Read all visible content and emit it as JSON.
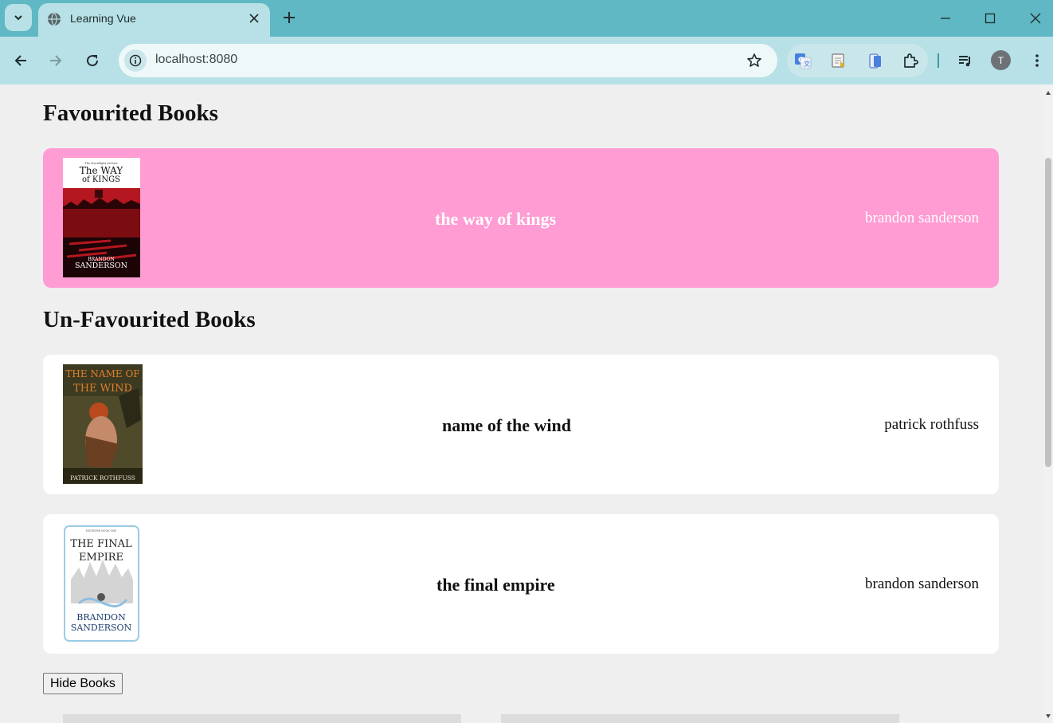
{
  "browser": {
    "tab_title": "Learning Vue",
    "url": "localhost:8080",
    "profile_initial": "T"
  },
  "page": {
    "favourited_heading": "Favourited Books",
    "unfavourited_heading": "Un-Favourited Books",
    "favourited_books": [
      {
        "title": "the way of kings",
        "author": "brandon sanderson",
        "cover": {
          "top_small": "The Stormlight Archive",
          "title_line1": "The WAY",
          "title_line2": "of KINGS",
          "author_line1": "BRANDON",
          "author_line2": "SANDERSON"
        }
      }
    ],
    "unfavourited_books": [
      {
        "title": "name of the wind",
        "author": "patrick rothfuss",
        "cover": {
          "title_line1": "THE NAME OF",
          "title_line2": "THE WIND",
          "author_line1": "PATRICK ROTHFUSS"
        }
      },
      {
        "title": "the final empire",
        "author": "brandon sanderson",
        "cover": {
          "top_small": "MISTBORN BOOK ONE",
          "title_line1": "THE FINAL",
          "title_line2": "EMPIRE",
          "author_line1": "BRANDON",
          "author_line2": "SANDERSON"
        }
      }
    ],
    "hide_button_label": "Hide Books"
  },
  "colors": {
    "favourite_card": "#ff9cd3",
    "chrome_tabbar": "#5fb8c3",
    "chrome_toolbar": "#b7e1e6"
  }
}
